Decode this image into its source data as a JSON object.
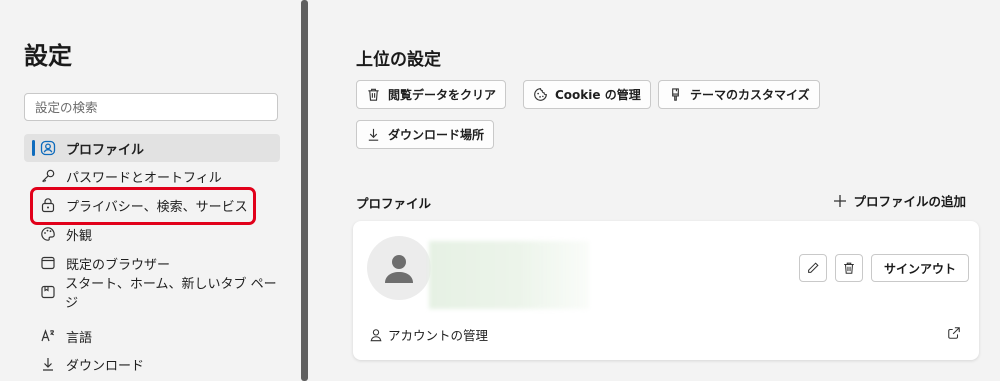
{
  "sidebar": {
    "title": "設定",
    "search_placeholder": "設定の検索",
    "items": [
      {
        "label": "プロファイル",
        "icon": "profile-icon",
        "active": true
      },
      {
        "label": "パスワードとオートフィル",
        "icon": "key-icon"
      },
      {
        "label": "プライバシー、検索、サービス",
        "icon": "lock-icon",
        "highlighted": true
      },
      {
        "label": "外観",
        "icon": "palette-icon"
      },
      {
        "label": "既定のブラウザー",
        "icon": "browser-window-icon"
      },
      {
        "label": "スタート、ホーム、新しいタブ ページ",
        "icon": "start-page-icon"
      },
      {
        "label": "言語",
        "icon": "language-icon"
      },
      {
        "label": "ダウンロード",
        "icon": "download-icon"
      }
    ]
  },
  "main": {
    "top_settings_title": "上位の設定",
    "quick_buttons": [
      {
        "label": "閲覧データをクリア",
        "icon": "trash-icon"
      },
      {
        "label": "Cookie の管理",
        "icon": "cookie-icon"
      },
      {
        "label": "テーマのカスタマイズ",
        "icon": "brush-icon"
      },
      {
        "label": "ダウンロード場所",
        "icon": "download-icon"
      }
    ],
    "profile_section": {
      "title": "プロファイル",
      "add_profile_label": "プロファイルの追加",
      "sign_out_label": "サインアウト",
      "manage_account_label": "アカウントの管理"
    }
  },
  "colors": {
    "accent": "#0f6cbd",
    "highlight_border": "#e1001a",
    "scrollbar": "#5f5f5f"
  }
}
